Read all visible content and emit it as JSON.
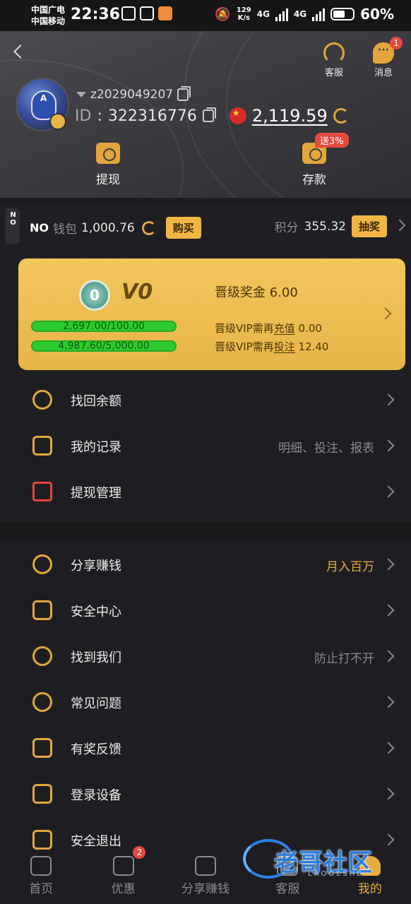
{
  "status_bar": {
    "carrier_1": "中国广电",
    "carrier_2": "中国移动",
    "time": "22:36",
    "speed_value": "129",
    "speed_unit": "K/s",
    "net_1": "4G",
    "net_2": "4G",
    "battery": "60%"
  },
  "header": {
    "customer_service_label": "客服",
    "messages_label": "消息",
    "messages_badge": "1",
    "username": "z2029049207",
    "id_label": "ID",
    "id_value": "322316776",
    "balance": "2,119.59",
    "withdraw_label": "提现",
    "deposit_label": "存款",
    "deposit_tag": "送3%"
  },
  "wallet": {
    "side_tab": "NO",
    "no_label": "NO",
    "wallet_label": "钱包",
    "wallet_value": "1,000.76",
    "buy_label": "购买",
    "points_label": "积分",
    "points_value": "355.32",
    "lottery_label": "抽奖"
  },
  "vip": {
    "emblem": "0",
    "level": "V0",
    "bonus_label": "晋级奖金",
    "bonus_value": "6.00",
    "deposit_progress_text": "2,697.00/100.00",
    "deposit_progress": 1.0,
    "bet_progress_text": "4,987.60/5,000.00",
    "bet_progress": 0.9975,
    "req_deposit_prefix": "晋级VIP需再",
    "req_deposit_link": "充值",
    "req_deposit_value": "0.00",
    "req_bet_prefix": "晋级VIP需再",
    "req_bet_link": "投注",
    "req_bet_value": "12.40"
  },
  "menu_group_1": [
    {
      "label": "找回余额",
      "value": ""
    },
    {
      "label": "我的记录",
      "value": "明细、投注、报表"
    },
    {
      "label": "提现管理",
      "value": ""
    }
  ],
  "menu_group_2": [
    {
      "label": "分享赚钱",
      "value": "月入百万"
    },
    {
      "label": "安全中心",
      "value": ""
    },
    {
      "label": "找到我们",
      "value": "防止打不开"
    },
    {
      "label": "常见问题",
      "value": ""
    },
    {
      "label": "有奖反馈",
      "value": ""
    },
    {
      "label": "登录设备",
      "value": ""
    },
    {
      "label": "安全退出",
      "value": ""
    }
  ],
  "bottom_nav": {
    "home": "首页",
    "promo": "优惠",
    "promo_badge": "2",
    "share": "分享赚钱",
    "service": "客服",
    "mine": "我的"
  },
  "watermark": {
    "text": "老哥社区",
    "sub": "LAOGESHE"
  },
  "colors": {
    "accent_gold": "#e6ac3f",
    "badge_red": "#e64a3f",
    "progress_green": "#2ecb2e",
    "background": "#1e1e22"
  }
}
